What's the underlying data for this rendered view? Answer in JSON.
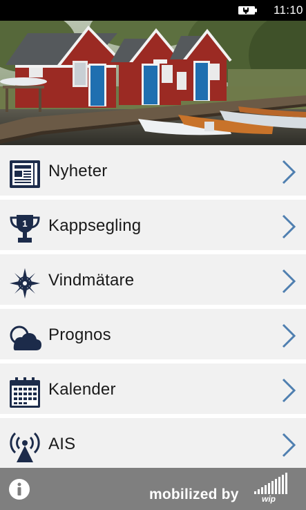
{
  "status_bar": {
    "time": "11:10",
    "battery_icon": "battery-charging-icon"
  },
  "hero": {
    "image": "boathouses-harbor-photo"
  },
  "menu": {
    "items": [
      {
        "label": "Nyheter",
        "icon": "newspaper-icon"
      },
      {
        "label": "Kappsegling",
        "icon": "trophy-icon"
      },
      {
        "label": "Vindmätare",
        "icon": "compass-rose-icon"
      },
      {
        "label": "Prognos",
        "icon": "cloud-icon"
      },
      {
        "label": "Kalender",
        "icon": "calendar-icon"
      },
      {
        "label": "AIS",
        "icon": "antenna-icon"
      }
    ],
    "chevron_icon": "chevron-right-icon"
  },
  "footer": {
    "brand": "mobilized by",
    "logo_text": "wip",
    "info_icon": "info-icon"
  },
  "colors": {
    "status_bar_bg": "#000000",
    "menu_item_bg": "#f1f1f1",
    "icon_navy": "#1c2b4a",
    "chevron_blue": "#4f7fb0",
    "footer_bg": "#7f7f7f",
    "text": "#1a1a1a"
  }
}
